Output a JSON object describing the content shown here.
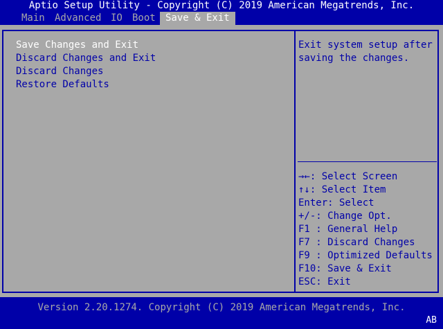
{
  "title": "Aptio Setup Utility - Copyright (C) 2019 American Megatrends, Inc.",
  "menu": {
    "tabs": [
      "Main",
      "Advanced",
      "IO",
      "Boot",
      "Save & Exit"
    ],
    "active_tab": "Save & Exit"
  },
  "options": [
    "Save Changes and Exit",
    "Discard Changes and Exit",
    "Discard Changes",
    "Restore Defaults"
  ],
  "selected_option": "Save Changes and Exit",
  "help": {
    "text": "Exit system setup after saving the changes."
  },
  "keys": [
    "→←: Select Screen",
    "↑↓: Select Item",
    "Enter: Select",
    "+/-: Change Opt.",
    "F1 : General Help",
    "F7 : Discard Changes",
    "F9 : Optimized Defaults",
    "F10: Save & Exit",
    "ESC: Exit"
  ],
  "footer": "Version 2.20.1274. Copyright (C) 2019 American Megatrends, Inc.",
  "corner_badge": "AB",
  "colors": {
    "background_blue": "#0000a8",
    "panel_gray": "#a8a8a8",
    "highlight_white": "#ffffff"
  }
}
